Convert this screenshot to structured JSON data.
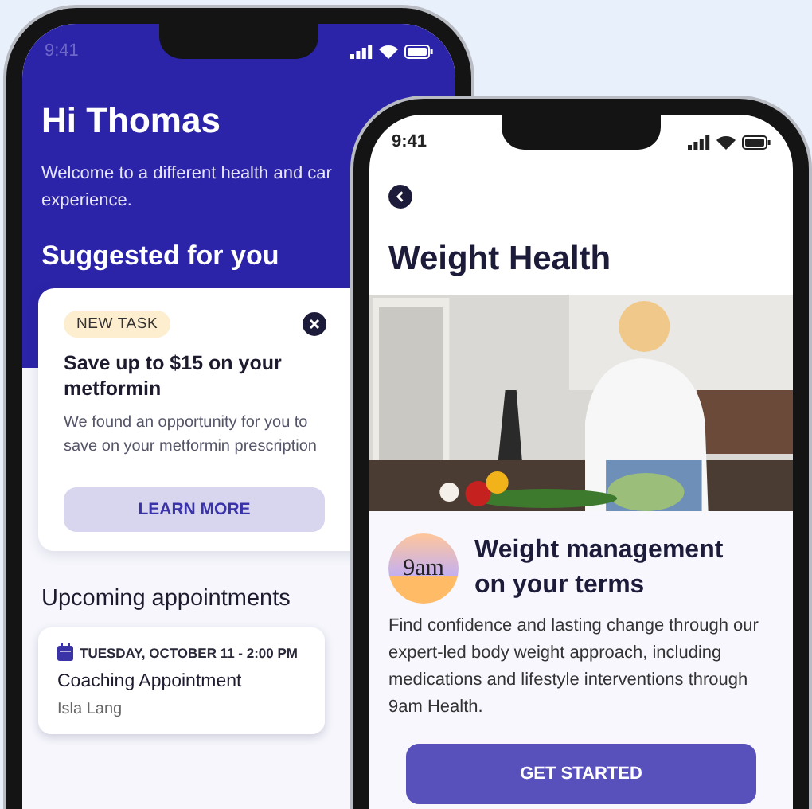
{
  "left_screen": {
    "status_time": "9:41",
    "greeting": "Hi Thomas",
    "welcome_lines": [
      "Welcome to a different health and car",
      "experience."
    ],
    "section_title": "Suggested for you",
    "task_card": {
      "tag": "NEW TASK",
      "title": "Save up to $15 on your metformin",
      "description": "We found an opportunity for you to save on your metformin prescription",
      "button": "LEARN MORE"
    },
    "appointments_title": "Upcoming appointments",
    "appointments": [
      {
        "date": "TUESDAY, OCTOBER 11 - 2:00 PM",
        "title": "Coaching Appointment",
        "person": "Isla Lang"
      }
    ]
  },
  "right_screen": {
    "status_time": "9:41",
    "title": "Weight Health",
    "logo": "9am",
    "heading": "Weight management on your terms",
    "body": "Find confidence and lasting change through our expert-led body weight approach, including medications and lifestyle interventions through 9am Health.",
    "button": "GET STARTED"
  }
}
